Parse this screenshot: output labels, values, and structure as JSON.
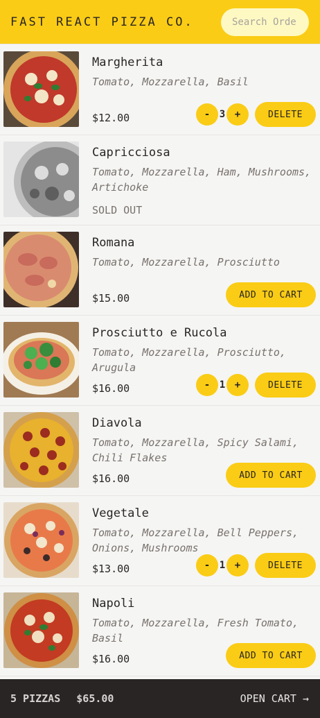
{
  "header": {
    "logo": "FAST REACT PIZZA CO.",
    "search_placeholder": "Search Order #"
  },
  "menu": [
    {
      "name": "Margherita",
      "ingredients": "Tomato, Mozzarella, Basil",
      "price": "$12.00",
      "sold_out": false,
      "in_cart": true,
      "quantity": "3",
      "action_label": "DELETE"
    },
    {
      "name": "Capricciosa",
      "ingredients": "Tomato, Mozzarella, Ham, Mushrooms, Artichoke",
      "status": "SOLD OUT",
      "sold_out": true,
      "in_cart": false
    },
    {
      "name": "Romana",
      "ingredients": "Tomato, Mozzarella, Prosciutto",
      "price": "$15.00",
      "sold_out": false,
      "in_cart": false,
      "action_label": "ADD TO CART"
    },
    {
      "name": "Prosciutto e Rucola",
      "ingredients": "Tomato, Mozzarella, Prosciutto, Arugula",
      "price": "$16.00",
      "sold_out": false,
      "in_cart": true,
      "quantity": "1",
      "action_label": "DELETE"
    },
    {
      "name": "Diavola",
      "ingredients": "Tomato, Mozzarella, Spicy Salami, Chili Flakes",
      "price": "$16.00",
      "sold_out": false,
      "in_cart": false,
      "action_label": "ADD TO CART"
    },
    {
      "name": "Vegetale",
      "ingredients": "Tomato, Mozzarella, Bell Peppers, Onions, Mushrooms",
      "price": "$13.00",
      "sold_out": false,
      "in_cart": true,
      "quantity": "1",
      "action_label": "DELETE"
    },
    {
      "name": "Napoli",
      "ingredients": "Tomato, Mozzarella, Fresh Tomato, Basil",
      "price": "$16.00",
      "sold_out": false,
      "in_cart": false,
      "action_label": "ADD TO CART"
    }
  ],
  "qty_controls": {
    "decrement": "-",
    "increment": "+"
  },
  "cart": {
    "count": "5 PIZZAS",
    "total": "$65.00",
    "open_label": "OPEN CART →"
  },
  "colors": {
    "accent": "#facc15",
    "background": "#f5f5f4",
    "dark": "#292524"
  }
}
